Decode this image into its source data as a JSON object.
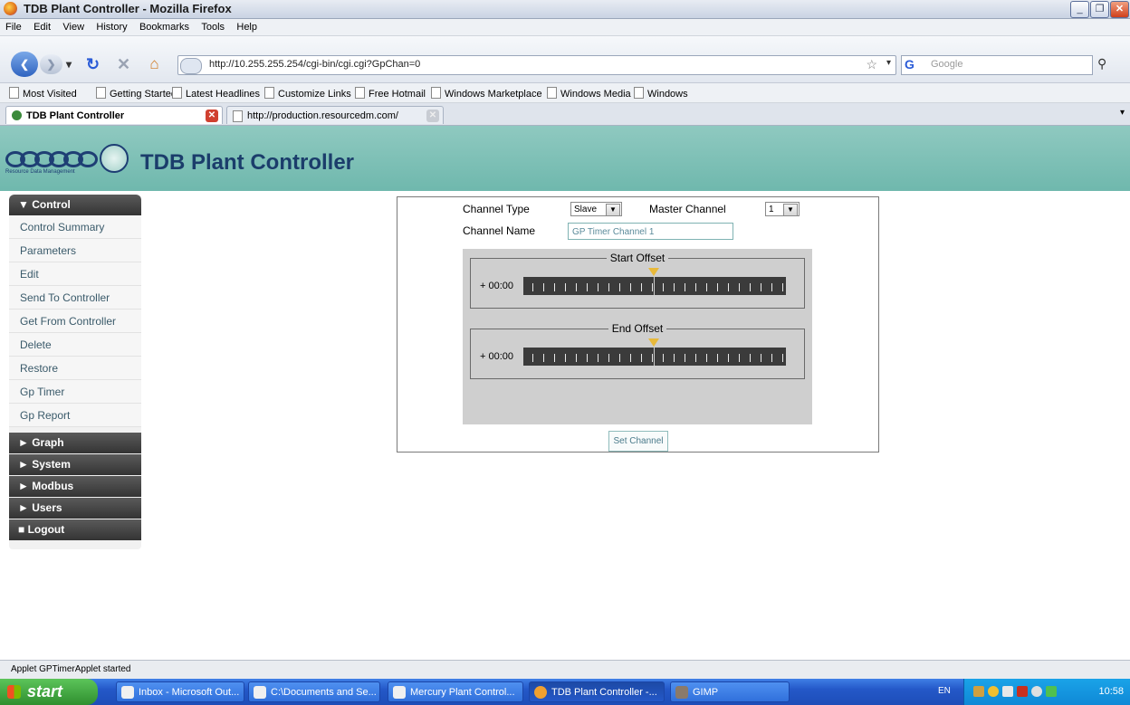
{
  "window": {
    "title": "TDB Plant Controller - Mozilla Firefox",
    "controls": [
      "_",
      "❐",
      "✕"
    ]
  },
  "menubar": [
    "File",
    "Edit",
    "View",
    "History",
    "Bookmarks",
    "Tools",
    "Help"
  ],
  "navbar": {
    "url": "http://10.255.255.254/cgi-bin/cgi.cgi?GpChan=0",
    "search_placeholder": "Google",
    "search_logo": "G"
  },
  "bookmarks": [
    "Most Visited",
    "Getting Started",
    "Latest Headlines",
    "Customize Links",
    "Free Hotmail",
    "Windows Marketplace",
    "Windows Media",
    "Windows"
  ],
  "tabs": [
    {
      "label": "TDB Plant Controller"
    },
    {
      "label": "http://production.resourcedm.com/"
    }
  ],
  "header": {
    "title": "TDB Plant Controller",
    "logo_text": "Resource Data Management"
  },
  "sidebar": {
    "control_header": "▼ Control",
    "items": [
      "Control Summary",
      "Parameters",
      "Edit",
      "Send To Controller",
      "Get From Controller",
      "Delete",
      "Restore",
      "Gp Timer",
      "Gp Report"
    ],
    "sections": [
      "► Graph",
      "► System",
      "► Modbus",
      "► Users",
      "■ Logout"
    ]
  },
  "panel": {
    "channel_type_label": "Channel Type",
    "channel_type_value": "Slave",
    "master_channel_label": "Master Channel",
    "master_channel_value": "1",
    "channel_name_label": "Channel Name",
    "channel_name_value": "GP Timer Channel 1",
    "start_offset": {
      "title": "Start Offset",
      "value": "+ 00:00"
    },
    "end_offset": {
      "title": "End Offset",
      "value": "+ 00:00"
    },
    "set_button": "Set Channel"
  },
  "status": {
    "text": "Applet GPTimerApplet started"
  },
  "taskbar": {
    "start": "start",
    "items": [
      "Inbox - Microsoft Out...",
      "C:\\Documents and Se...",
      "Mercury Plant Control...",
      "TDB Plant Controller -...",
      "GIMP"
    ],
    "language": "EN",
    "clock": "10:58"
  }
}
